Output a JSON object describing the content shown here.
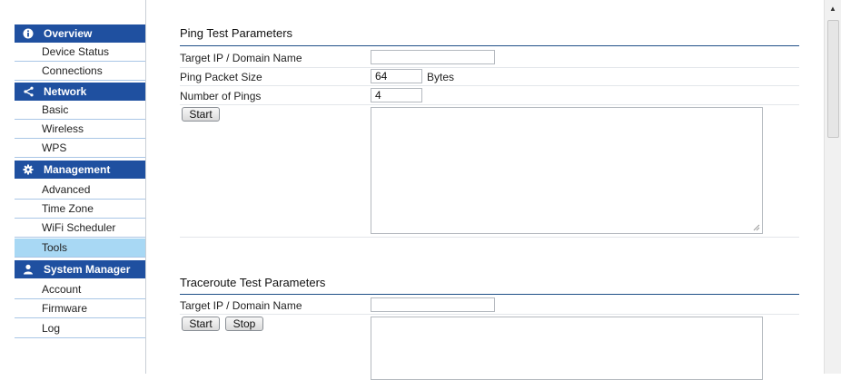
{
  "sidebar": {
    "overview": {
      "label": "Overview",
      "icon": "info-icon",
      "items": [
        "Device Status",
        "Connections"
      ]
    },
    "network": {
      "label": "Network",
      "icon": "share-icon",
      "items": [
        "Basic",
        "Wireless",
        "WPS"
      ]
    },
    "management": {
      "label": "Management",
      "icon": "gear-icon",
      "items": [
        "Advanced",
        "Time Zone",
        "WiFi Scheduler",
        "Tools"
      ],
      "active": "Tools"
    },
    "system": {
      "label": "System Manager",
      "icon": "user-icon",
      "items": [
        "Account",
        "Firmware",
        "Log"
      ]
    },
    "header_color": "#1f50a0",
    "active_color": "#a8d8f4"
  },
  "ping": {
    "title": "Ping Test Parameters",
    "target_label": "Target IP / Domain Name",
    "target_value": "",
    "size_label": "Ping Packet Size",
    "size_value": "64",
    "size_unit": "Bytes",
    "count_label": "Number of Pings",
    "count_value": "4",
    "start_label": "Start"
  },
  "traceroute": {
    "title": "Traceroute Test Parameters",
    "target_label": "Target IP / Domain Name",
    "target_value": "",
    "start_label": "Start",
    "stop_label": "Stop"
  }
}
